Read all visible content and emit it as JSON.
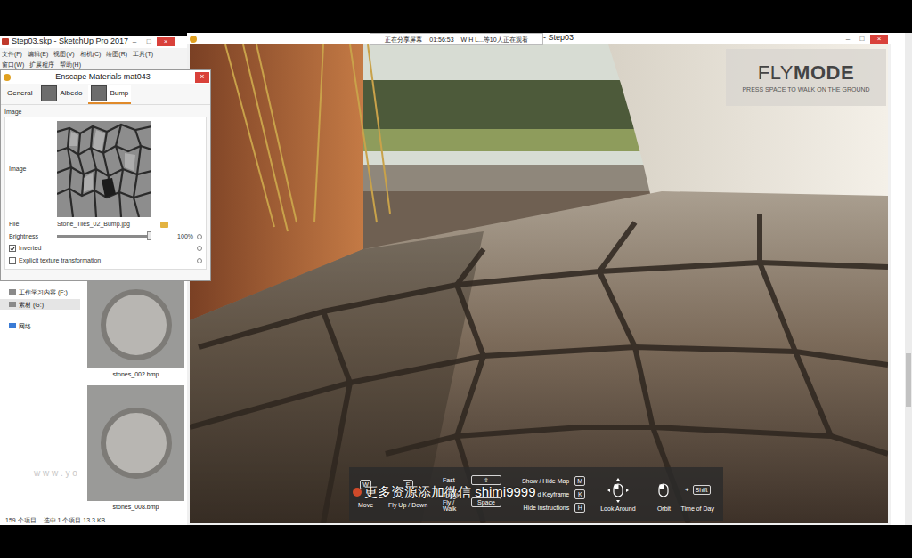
{
  "screen_share": {
    "status": "正在分享屏幕",
    "time": "01:56:53",
    "viewers": "W H L...等10人正在观看"
  },
  "sketchup": {
    "title": "Step03.skp - SketchUp Pro 2017",
    "window_buttons": [
      "–",
      "□",
      "×"
    ],
    "menu_rows": [
      [
        "文件(F)",
        "编辑(E)",
        "视图(V)",
        "相机(C)",
        "绘图(R)",
        "工具(T)"
      ],
      [
        "窗口(W)",
        "扩展程序",
        "帮助(H)"
      ]
    ]
  },
  "enscape_window": {
    "title": "- Step03",
    "window_buttons": [
      "–",
      "□",
      "×"
    ]
  },
  "materials_dialog": {
    "title": "Enscape Materials mat043",
    "close": "×",
    "tabs": [
      {
        "label": "General",
        "selected": false,
        "thumbnail": false
      },
      {
        "label": "Albedo",
        "selected": false,
        "thumbnail": true
      },
      {
        "label": "Bump",
        "selected": true,
        "thumbnail": true
      }
    ],
    "group": "Image",
    "image_label": "Image",
    "file_label": "File",
    "file": "Stone_Tiles_02_Bump.jpg",
    "brightness": {
      "label": "Brightness",
      "level": 1,
      "reading": "100%"
    },
    "checkboxes": [
      {
        "label": "Inverted",
        "checked": true
      },
      {
        "label": "Explicit texture transformation",
        "checked": false
      }
    ]
  },
  "explorer": {
    "nav": [
      {
        "label": "工作学习内容 (F:)",
        "selected": false,
        "kind": "drive"
      },
      {
        "label": "素材 (G:)",
        "selected": true,
        "kind": "drive"
      },
      {
        "label": "网络",
        "selected": false,
        "kind": "network"
      }
    ],
    "files": [
      {
        "name": "stones_002.bmp",
        "selected": false
      },
      {
        "name": "stones_008.bmp",
        "selected": false
      }
    ],
    "status": {
      "count": "159 个项目",
      "selection": "选中 1 个项目 13.3 KB"
    }
  },
  "flymode": {
    "title_light": "FLY",
    "title_bold": "MODE",
    "hint": "PRESS SPACE TO WALK ON THE GROUND"
  },
  "controls": {
    "single": [
      {
        "key": "W",
        "label": "Move"
      },
      {
        "key": "E",
        "label": "Fly Up / Down"
      }
    ],
    "middle": [
      {
        "label": "Fast",
        "key": "⇧"
      },
      {
        "label": "Toggle Fly / Walk",
        "key": "Space"
      }
    ],
    "right": [
      {
        "label": "Show / Hide Map",
        "key": "M"
      },
      {
        "label": "d Keyframe",
        "key": "K"
      },
      {
        "label": "Hide instructions",
        "key": "H"
      }
    ],
    "look": {
      "label": "Look Around"
    },
    "orbit": {
      "label": "Orbit",
      "plus": "+",
      "key": "Shift",
      "key_label": "Time of Day"
    }
  },
  "watermark": "更多资源添加微信 shimi9999",
  "site_watermark": "w w w . y o"
}
